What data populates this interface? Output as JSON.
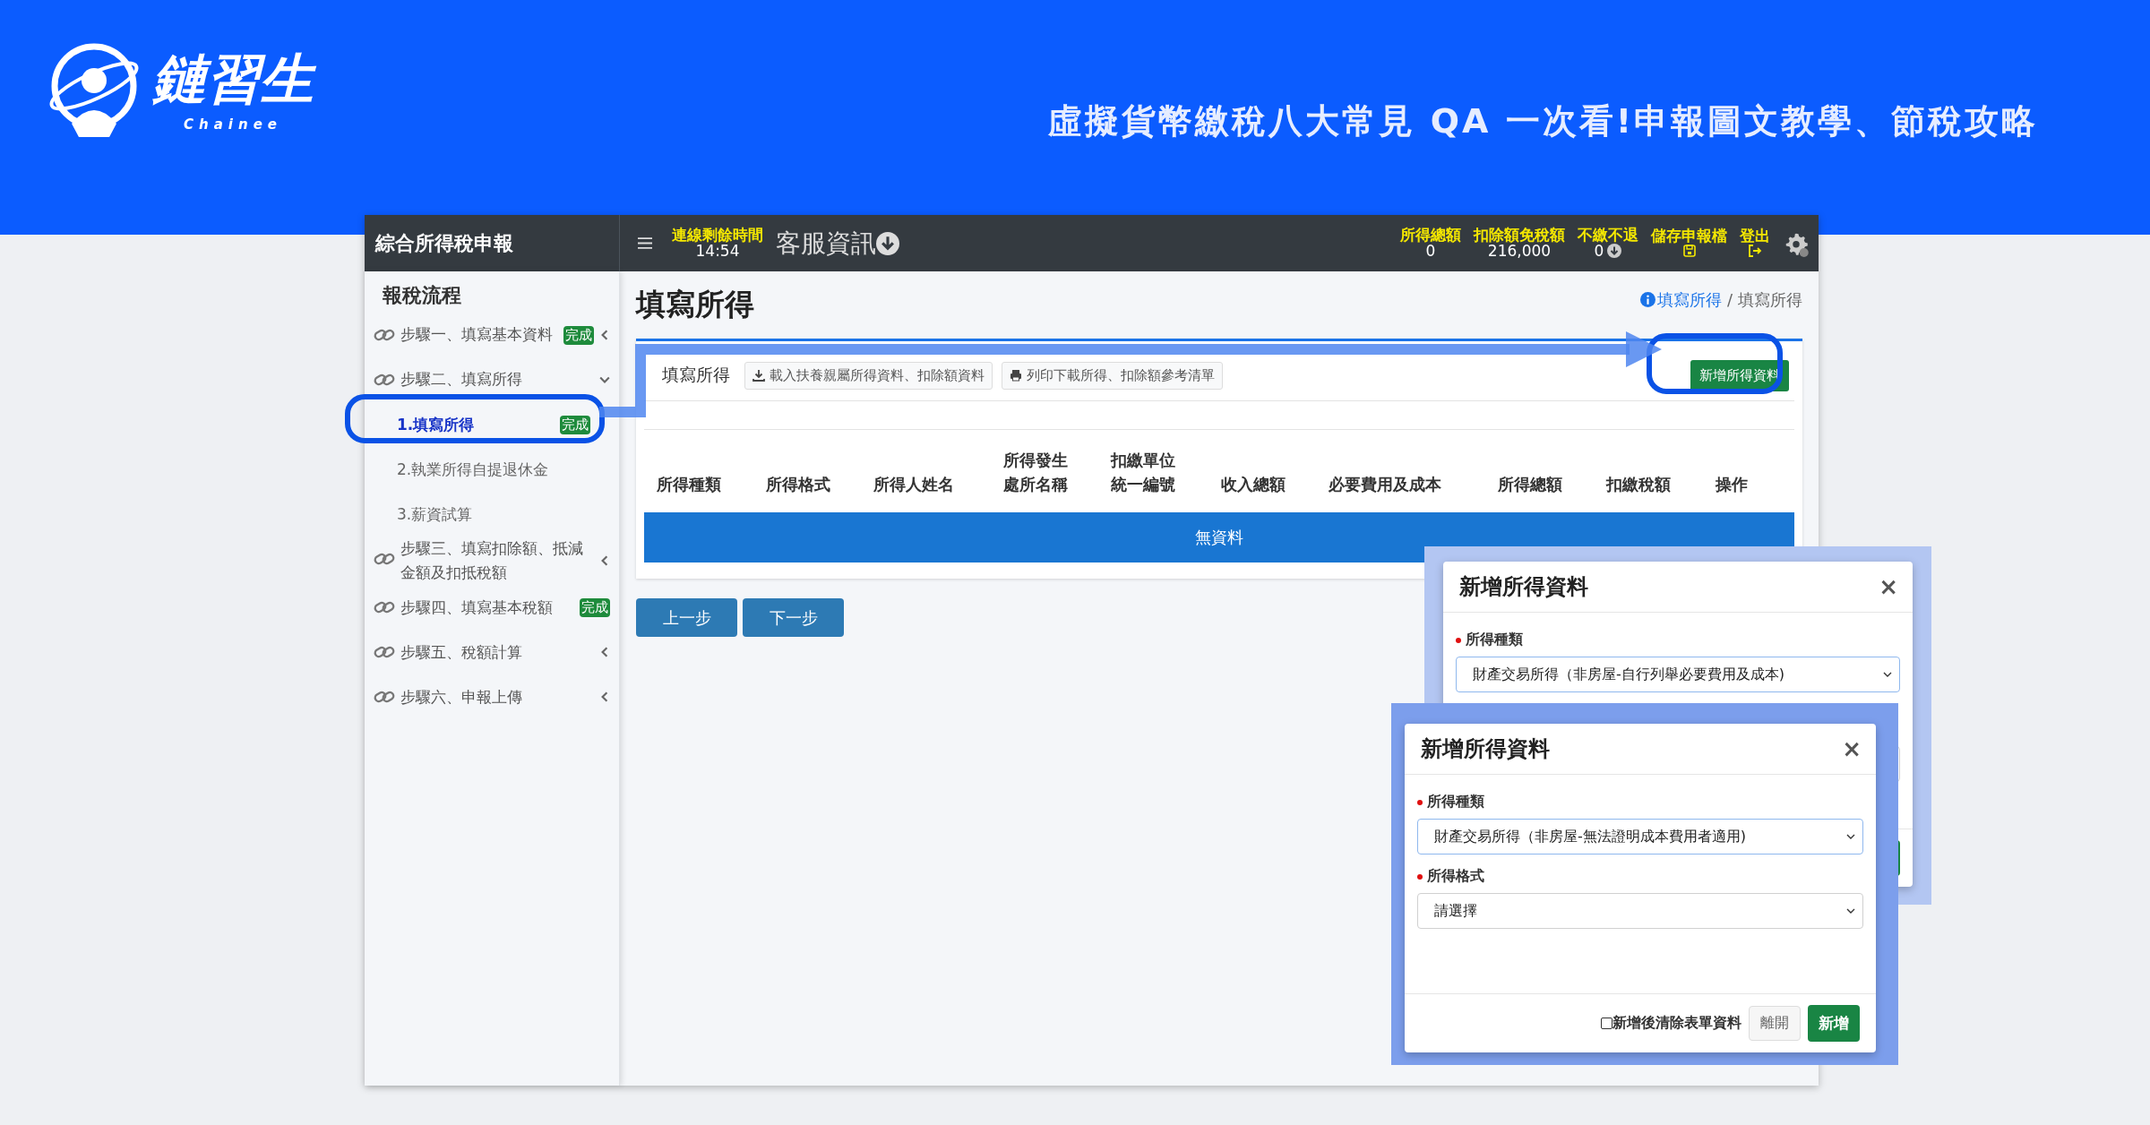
{
  "banner": {
    "brand": "鏈習生",
    "brand_sub": "Chainee",
    "headline": "虛擬貨幣繳稅八大常見 QA 一次看!申報圖文教學、節稅攻略"
  },
  "app": {
    "title": "綜合所得稅申報",
    "session": {
      "label": "連線剩餘時間",
      "value": "14:54"
    },
    "service": "客服資訊",
    "stats": [
      {
        "label": "所得總額",
        "value": "0",
        "kind": "text"
      },
      {
        "label": "扣除額免稅額",
        "value": "216,000",
        "kind": "text"
      },
      {
        "label": "不繳不退",
        "value": "0",
        "kind": "info"
      },
      {
        "label": "儲存申報檔",
        "kind": "save"
      },
      {
        "label": "登出",
        "kind": "logout"
      }
    ]
  },
  "sidebar": {
    "heading": "報稅流程",
    "items": [
      {
        "label": "步驟一、填寫基本資料",
        "badge": "完成",
        "expanded": false
      },
      {
        "label": "步驟二、填寫所得",
        "expanded": true,
        "children": [
          {
            "label": "1.填寫所得",
            "badge": "完成",
            "selected": true
          },
          {
            "label": "2.執業所得自提退休金",
            "selected": false
          },
          {
            "label": "3.薪資試算",
            "selected": false
          }
        ]
      },
      {
        "label": "步驟三、填寫扣除額、抵減金額及扣抵稅額",
        "expanded": false
      },
      {
        "label": "步驟四、填寫基本稅額",
        "badge": "完成"
      },
      {
        "label": "步驟五、稅額計算",
        "expanded": false
      },
      {
        "label": "步驟六、申報上傳",
        "expanded": false
      }
    ]
  },
  "page": {
    "title": "填寫所得",
    "breadcrumb": [
      {
        "label": "填寫所得",
        "kind": "link"
      },
      {
        "label": "/",
        "kind": "separator"
      },
      {
        "label": "填寫所得",
        "kind": "current"
      }
    ]
  },
  "card": {
    "tab": "填寫所得",
    "tools": [
      {
        "label": "載入扶養親屬所得資料、扣除額資料",
        "kind": "download"
      },
      {
        "label": "列印下載所得、扣除額參考清單",
        "kind": "print"
      }
    ],
    "add_button": "新增所得資料"
  },
  "table": {
    "columns": [
      "所得種類",
      "所得格式",
      "所得人姓名",
      "所得發生處所名稱",
      "扣繳單位統一編號",
      "收入總額",
      "必要費用及成本",
      "所得總額",
      "扣繳稅額",
      "操作"
    ],
    "empty": "無資料"
  },
  "nav_buttons": [
    "上一步",
    "下一步"
  ],
  "back_modal": {
    "title": "新增所得資料",
    "close": "×",
    "field": {
      "label": "所得種類",
      "value": "財產交易所得（非房屋-自行列舉必要費用及成本)",
      "required": true
    }
  },
  "front_modal": {
    "title": "新增所得資料",
    "close": "×",
    "fields": [
      {
        "label": "所得種類",
        "value": "財產交易所得（非房屋-無法證明成本費用者適用)",
        "required": true,
        "focused": true
      },
      {
        "label": "所得格式",
        "value": "請選擇",
        "required": true,
        "focused": false
      }
    ],
    "clear_option": {
      "label": "新增後清除表單資料",
      "checked": false
    },
    "close_button": "離開",
    "submit_button": "新增"
  }
}
